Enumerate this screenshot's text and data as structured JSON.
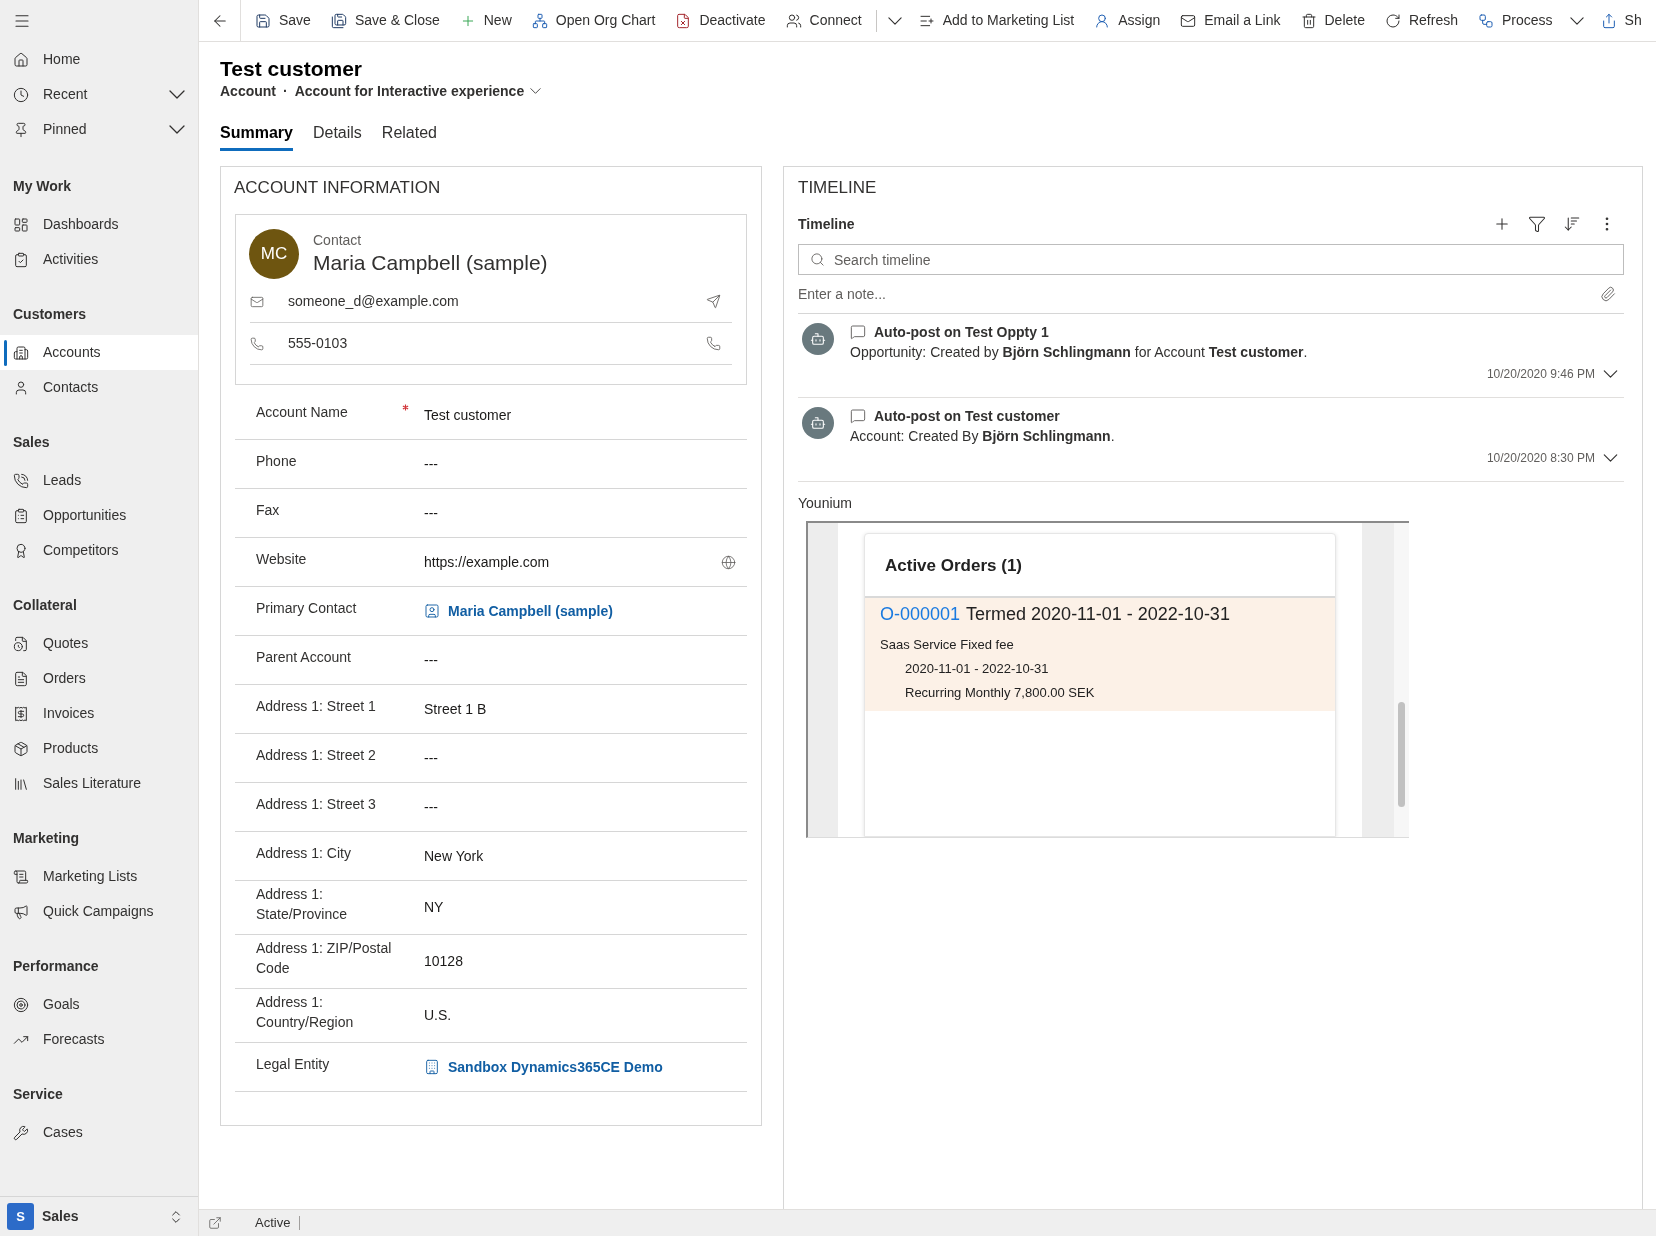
{
  "sidebar": {
    "top_items": [
      {
        "label": "Home",
        "expandable": false
      },
      {
        "label": "Recent",
        "expandable": true
      },
      {
        "label": "Pinned",
        "expandable": true
      }
    ],
    "groups": [
      {
        "title": "My Work",
        "items": [
          {
            "label": "Dashboards",
            "selected": false
          },
          {
            "label": "Activities",
            "selected": false
          }
        ]
      },
      {
        "title": "Customers",
        "items": [
          {
            "label": "Accounts",
            "selected": true
          },
          {
            "label": "Contacts",
            "selected": false
          }
        ]
      },
      {
        "title": "Sales",
        "items": [
          {
            "label": "Leads",
            "selected": false
          },
          {
            "label": "Opportunities",
            "selected": false
          },
          {
            "label": "Competitors",
            "selected": false
          }
        ]
      },
      {
        "title": "Collateral",
        "items": [
          {
            "label": "Quotes",
            "selected": false
          },
          {
            "label": "Orders",
            "selected": false
          },
          {
            "label": "Invoices",
            "selected": false
          },
          {
            "label": "Products",
            "selected": false
          },
          {
            "label": "Sales Literature",
            "selected": false
          }
        ]
      },
      {
        "title": "Marketing",
        "items": [
          {
            "label": "Marketing Lists",
            "selected": false
          },
          {
            "label": "Quick Campaigns",
            "selected": false
          }
        ]
      },
      {
        "title": "Performance",
        "items": [
          {
            "label": "Goals",
            "selected": false
          },
          {
            "label": "Forecasts",
            "selected": false
          }
        ]
      },
      {
        "title": "Service",
        "items": [
          {
            "label": "Cases",
            "selected": false
          }
        ]
      }
    ],
    "area_switcher": {
      "badge": "S",
      "label": "Sales"
    }
  },
  "command_bar": {
    "items": [
      {
        "kind": "button",
        "label": "Save"
      },
      {
        "kind": "button",
        "label": "Save & Close"
      },
      {
        "kind": "button",
        "label": "New"
      },
      {
        "kind": "button",
        "label": "Open Org Chart"
      },
      {
        "kind": "button",
        "label": "Deactivate"
      },
      {
        "kind": "button",
        "label": "Connect"
      },
      {
        "kind": "divider"
      },
      {
        "kind": "dropdown"
      },
      {
        "kind": "button",
        "label": "Add to Marketing List"
      },
      {
        "kind": "button",
        "label": "Assign"
      },
      {
        "kind": "button",
        "label": "Email a Link"
      },
      {
        "kind": "button",
        "label": "Delete"
      },
      {
        "kind": "button",
        "label": "Refresh"
      },
      {
        "kind": "button",
        "label": "Process"
      },
      {
        "kind": "dropdown"
      },
      {
        "kind": "button",
        "label": "Sh"
      }
    ]
  },
  "record": {
    "title": "Test customer",
    "entity": "Account",
    "separator": "·",
    "form": "Account for Interactive experience"
  },
  "tabs": [
    {
      "label": "Summary",
      "selected": true
    },
    {
      "label": "Details",
      "selected": false
    },
    {
      "label": "Related",
      "selected": false
    }
  ],
  "account_information": {
    "title": "ACCOUNT INFORMATION",
    "contact_card": {
      "initials": "MC",
      "caption": "Contact",
      "name": "Maria Campbell (sample)",
      "rows": [
        {
          "kind": "email",
          "value": "someone_d@example.com"
        },
        {
          "kind": "phone",
          "value": "555-0103"
        }
      ]
    },
    "fields": [
      {
        "label": "Account Name",
        "required": true,
        "kind": "text",
        "value": "Test customer"
      },
      {
        "label": "Phone",
        "required": false,
        "kind": "text",
        "value": "---"
      },
      {
        "label": "Fax",
        "required": false,
        "kind": "text",
        "value": "---"
      },
      {
        "label": "Website",
        "required": false,
        "kind": "url",
        "value": "https://example.com"
      },
      {
        "label": "Primary Contact",
        "required": false,
        "kind": "contact",
        "value": "Maria Campbell (sample)"
      },
      {
        "label": "Parent Account",
        "required": false,
        "kind": "text",
        "value": "---"
      },
      {
        "label": "Address 1: Street 1",
        "required": false,
        "kind": "text",
        "value": "Street 1 B"
      },
      {
        "label": "Address 1: Street 2",
        "required": false,
        "kind": "text",
        "value": "---"
      },
      {
        "label": "Address 1: Street 3",
        "required": false,
        "kind": "text",
        "value": "---"
      },
      {
        "label": "Address 1: City",
        "required": false,
        "kind": "text",
        "value": "New York"
      },
      {
        "label": "Address 1: State/Province",
        "required": false,
        "kind": "text",
        "value": "NY"
      },
      {
        "label": "Address 1: ZIP/Postal Code",
        "required": false,
        "kind": "text",
        "value": "10128"
      },
      {
        "label": "Address 1: Country/Region",
        "required": false,
        "kind": "text",
        "value": "U.S."
      },
      {
        "label": "Legal Entity",
        "required": false,
        "kind": "entity",
        "value": "Sandbox Dynamics365CE Demo"
      }
    ]
  },
  "timeline": {
    "title": "TIMELINE",
    "header": "Timeline",
    "search": {
      "placeholder": "Search timeline"
    },
    "note": {
      "placeholder": "Enter a note..."
    },
    "posts": [
      {
        "title": "Auto-post on Test Oppty 1",
        "body": "Opportunity: Created by **Björn Schlingmann** for Account **Test customer**.",
        "time": "10/20/2020 9:46 PM"
      },
      {
        "title": "Auto-post on Test customer",
        "body": "Account: Created By **Björn Schlingmann**.",
        "time": "10/20/2020 8:30 PM"
      }
    ]
  },
  "younium": {
    "label": "Younium",
    "widget": {
      "title": "Active Orders (1)",
      "orders": [
        {
          "number": "O-000001",
          "status": "Termed 2020-11-01 - 2022-10-31",
          "product": "Saas Service Fixed fee",
          "period": "2020-11-01 - 2022-10-31",
          "price": "Recurring Monthly 7,800.00 SEK"
        }
      ]
    }
  },
  "status_bar": {
    "status": "Active"
  }
}
